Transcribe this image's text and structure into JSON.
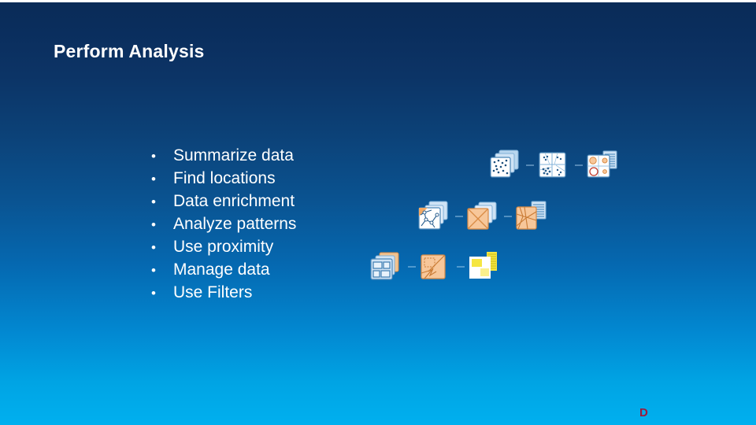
{
  "slide": {
    "title": "Perform Analysis",
    "background": {
      "gradient_top": "#0a2c57",
      "gradient_bottom": "#00b0ef"
    },
    "text_color": "#ffffff"
  },
  "bullets": {
    "marker": "•",
    "items": [
      {
        "label": "Summarize data"
      },
      {
        "label": "Find locations"
      },
      {
        "label": "Data enrichment"
      },
      {
        "label": "Analyze patterns"
      },
      {
        "label": "Use proximity"
      },
      {
        "label": "Manage data"
      },
      {
        "label": "Use Filters"
      }
    ]
  },
  "icon_cluster": {
    "rows": [
      {
        "icons": [
          {
            "name": "scattered-points-layers-icon",
            "palette": "blue"
          },
          {
            "name": "clustered-points-quadrant-map-icon",
            "palette": "blue"
          },
          {
            "name": "symbolized-map-with-table-icon",
            "palette": "blue-orange"
          }
        ]
      },
      {
        "icons": [
          {
            "name": "network-trace-map-layers-icon",
            "palette": "orange-blue"
          },
          {
            "name": "intersect-overlay-layers-icon",
            "palette": "orange-blue"
          },
          {
            "name": "road-network-map-with-table-icon",
            "palette": "orange-blue"
          }
        ]
      },
      {
        "icons": [
          {
            "name": "parcel-blocks-layers-icon",
            "palette": "blue-orange"
          },
          {
            "name": "proximity-direction-map-icon",
            "palette": "orange"
          },
          {
            "name": "filter-blocks-list-icon",
            "palette": "yellow"
          }
        ]
      }
    ],
    "colors": {
      "blue_fill": "#cfe3f5",
      "blue_line": "#4a86b8",
      "orange_fill": "#f7c79a",
      "orange_line": "#d98b45",
      "yellow_fill": "#f5e642",
      "white_fill": "#ffffff"
    }
  },
  "corner_mark": {
    "text": "D",
    "color": "#9c1b3c"
  }
}
